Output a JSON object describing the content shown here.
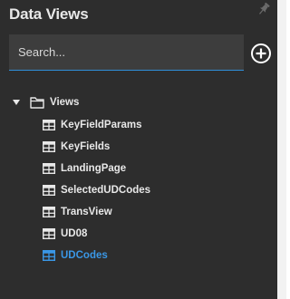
{
  "panel": {
    "title": "Data Views",
    "pin_icon": "pin-icon",
    "add_icon": "add-circle-icon"
  },
  "search": {
    "placeholder": "Search...",
    "value": ""
  },
  "tree": {
    "root": {
      "label": "Views",
      "icon": "folder-icon",
      "expanded": true
    },
    "items": [
      {
        "label": "KeyFieldParams",
        "icon": "table-icon"
      },
      {
        "label": "KeyFields",
        "icon": "table-icon"
      },
      {
        "label": "LandingPage",
        "icon": "table-icon"
      },
      {
        "label": "SelectedUDCodes",
        "icon": "table-icon"
      },
      {
        "label": "TransView",
        "icon": "table-icon"
      },
      {
        "label": "UD08",
        "icon": "table-icon"
      },
      {
        "label": "UDCodes",
        "icon": "table-icon",
        "selected": true
      }
    ]
  },
  "colors": {
    "panel_bg": "#2d2d2d",
    "text": "#e8e8e8",
    "accent": "#3a97e6"
  }
}
